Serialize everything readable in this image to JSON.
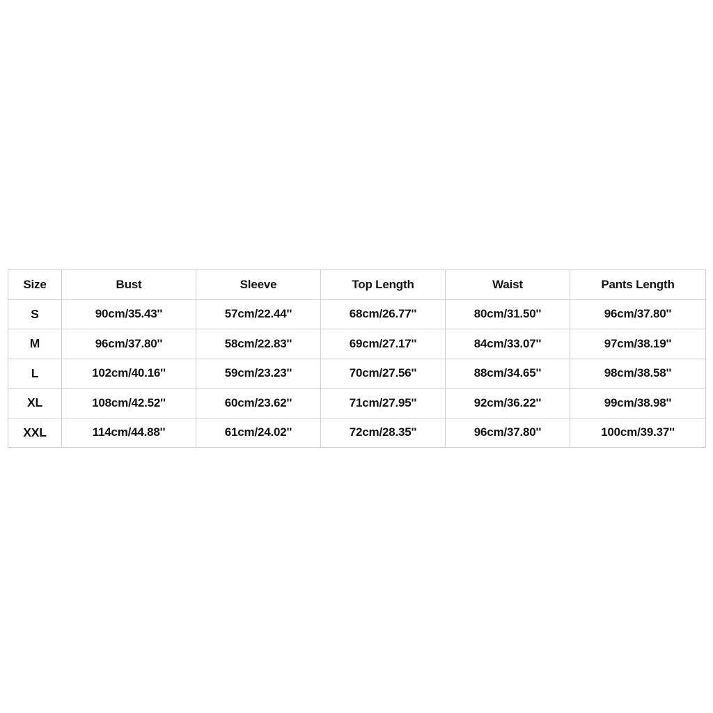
{
  "page": {
    "background_color": "#ffffff",
    "border_color": "#cfcfcf",
    "text_color": "#141414"
  },
  "size_chart": {
    "title": "",
    "columns": [
      "Size",
      "Bust",
      "Sleeve",
      "Top Length",
      "Waist",
      "Pants Length"
    ],
    "rows": [
      {
        "size": "S",
        "bust": "90cm/35.43''",
        "sleeve": "57cm/22.44''",
        "top_length": "68cm/26.77''",
        "waist": "80cm/31.50''",
        "pants_length": "96cm/37.80''"
      },
      {
        "size": "M",
        "bust": "96cm/37.80''",
        "sleeve": "58cm/22.83''",
        "top_length": "69cm/27.17''",
        "waist": "84cm/33.07''",
        "pants_length": "97cm/38.19''"
      },
      {
        "size": "L",
        "bust": "102cm/40.16''",
        "sleeve": "59cm/23.23''",
        "top_length": "70cm/27.56''",
        "waist": "88cm/34.65''",
        "pants_length": "98cm/38.58''"
      },
      {
        "size": "XL",
        "bust": "108cm/42.52''",
        "sleeve": "60cm/23.62''",
        "top_length": "71cm/27.95''",
        "waist": "92cm/36.22''",
        "pants_length": "99cm/38.98''"
      },
      {
        "size": "XXL",
        "bust": "114cm/44.88''",
        "sleeve": "61cm/24.02''",
        "top_length": "72cm/28.35''",
        "waist": "96cm/37.80''",
        "pants_length": "100cm/39.37''"
      }
    ]
  }
}
